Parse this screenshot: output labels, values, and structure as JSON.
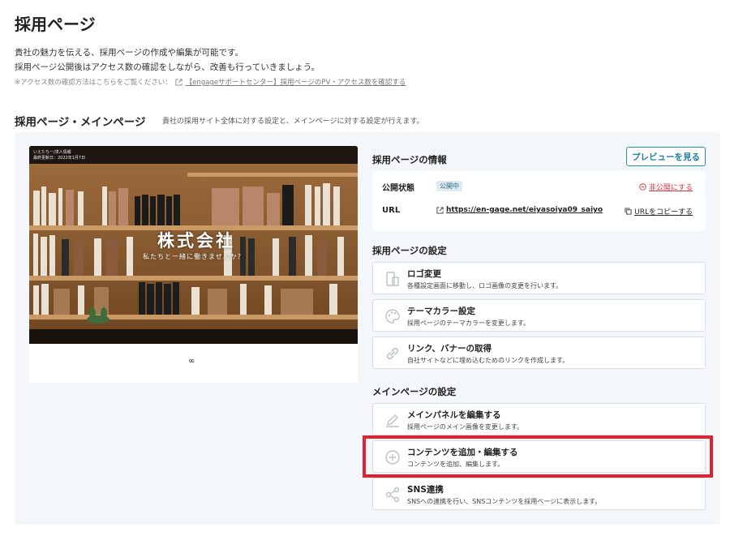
{
  "header": {
    "title": "採用ページ",
    "desc1": "貴社の魅力を伝える、採用ページの作成や編集が可能です。",
    "desc2": "採用ページ公開後はアクセス数の確認をしながら、改善も行っていきましょう。",
    "note_prefix": "※アクセス数の確認方法はこちらをご覧ください：",
    "note_link": "【engageサポートセンター】採用ページのPV・アクセス数を確認する"
  },
  "section": {
    "title": "採用ページ・メインページ",
    "desc": "貴社の採用サイト全体に対する設定と、メインページに対する設定が行えます。"
  },
  "preview": {
    "small_line1": "いえたちー/求人情報",
    "small_line2": "最終更新日：2022年1月7日",
    "company": "株式会社",
    "catch": "私たちと一緒に働きませんか？",
    "footer_symbol": "∞"
  },
  "info": {
    "heading": "採用ページの情報",
    "preview_button": "プレビューを見る",
    "status_label": "公開状態",
    "status_badge": "公開中",
    "unpublish": "非公開にする",
    "url_label": "URL",
    "url_value": "https://en-gage.net/eiyasoiya09_saiyo",
    "copy_url": "URLをコピーする"
  },
  "page_settings": {
    "heading": "採用ページの設定",
    "items": [
      {
        "title": "ロゴ変更",
        "sub": "各種設定画面に移動し、ロゴ画像の変更を行います。",
        "icon": "logo-icon"
      },
      {
        "title": "テーマカラー設定",
        "sub": "採用ページのテーマカラーを変更します。",
        "icon": "palette-icon"
      },
      {
        "title": "リンク、バナーの取得",
        "sub": "自社サイトなどに埋め込むためのリンクを作成します。",
        "icon": "link-icon"
      }
    ]
  },
  "main_settings": {
    "heading": "メインページの設定",
    "items": [
      {
        "title": "メインパネルを編集する",
        "sub": "採用ページのメイン画像を変更します。",
        "icon": "pencil-icon"
      },
      {
        "title": "コンテンツを追加・編集する",
        "sub": "コンテンツを追加、編集します。",
        "icon": "plus-circle-icon"
      },
      {
        "title": "SNS連携",
        "sub": "SNSへの連携を行い、SNSコンテンツを採用ページに表示します。",
        "icon": "share-icon"
      }
    ]
  },
  "colors": {
    "accent": "#2a8ea8",
    "danger": "#d9363e",
    "highlight": "#e3202e",
    "panel_bg": "#f4f7fa"
  }
}
